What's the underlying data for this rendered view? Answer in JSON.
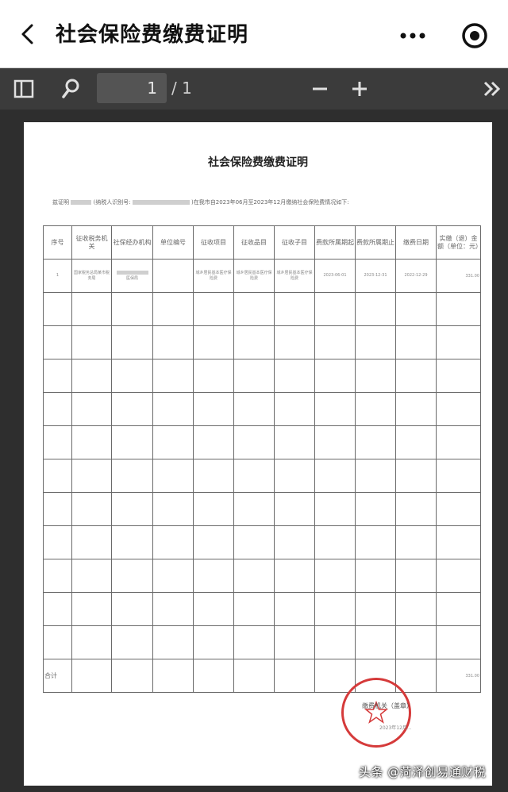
{
  "header": {
    "title": "社会保险费缴费证明",
    "back_icon": "chevron-left-icon",
    "more_icon": "more-dots-icon",
    "close_icon": "target-circle-icon"
  },
  "toolbar": {
    "page_current": "1",
    "page_total": "/ 1",
    "sidebar_icon": "sidebar-toggle-icon",
    "search_icon": "search-icon",
    "zoom_out_icon": "minus-icon",
    "zoom_in_icon": "plus-icon",
    "more_icon": "double-chevron-right-icon"
  },
  "document": {
    "title": "社会保险费缴费证明",
    "intro_prefix": "兹证明",
    "intro_mid": "(纳税人识别号:",
    "intro_suffix": ")在我市自2023年06月至2023年12月缴纳社会保险费情况如下:",
    "headers": [
      "序号",
      "征收税务机关",
      "社保经办机构",
      "单位编号",
      "征收项目",
      "征收品目",
      "征收子目",
      "费款所属期起",
      "费款所属期止",
      "缴费日期",
      "实缴（退）金额（单位：元）"
    ],
    "row1": {
      "index": "1",
      "tax_office": "国家税务总局某市税务局",
      "social_office": "医保局",
      "project": "城乡居民基本医疗保险费",
      "item": "城乡居民基本医疗保险费",
      "subitem": "城乡居民基本医疗保险费",
      "period_start": "2023-06-01",
      "period_end": "2023-12-31",
      "pay_date": "2022-12-29",
      "amount": "331.00"
    },
    "total_label": "合计",
    "total_amount": "331.00",
    "stamp_text": "缴费机关（盖章）",
    "stamp_date": "2023年12月..."
  },
  "watermark": "头条 @菏泽创易通财税",
  "colors": {
    "toolbar_bg": "#3b3b3b",
    "viewer_bg": "#2e2e2e",
    "stamp_red": "#d53a3a"
  }
}
